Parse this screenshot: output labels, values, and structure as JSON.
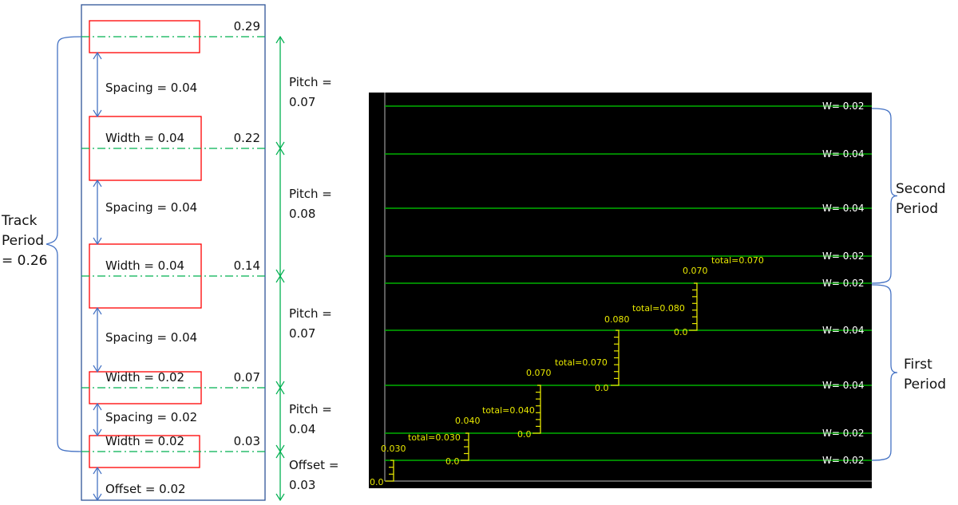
{
  "colors": {
    "frame": "#2f5597",
    "track": "#ff0000",
    "center": "#00b050",
    "arrow": "#4472c4",
    "pitch": "#00b050",
    "grid": "#00b000",
    "ruler": "#e8e800",
    "axis": "#999999",
    "bg": "#000000"
  },
  "left": {
    "track_values": [
      "0.29",
      "0.22",
      "0.14",
      "0.07",
      "0.03"
    ],
    "labels": [
      "Spacing = 0.04",
      "Width  = 0.04",
      "Spacing = 0.04",
      "Width = 0.04",
      "Spacing = 0.04",
      "Width = 0.02",
      "Spacing = 0.02",
      "Width = 0.02",
      "Offset = 0.02"
    ],
    "pitch": [
      [
        "Pitch =",
        "0.07"
      ],
      [
        "Pitch =",
        "0.08"
      ],
      [
        "Pitch =",
        "0.07"
      ],
      [
        "Pitch =",
        "0.04"
      ],
      [
        "Offset =",
        "0.03"
      ]
    ],
    "track_period": [
      "Track",
      "Period",
      "= 0.26"
    ]
  },
  "right": {
    "widths": [
      "W=  0.02",
      "W=  0.04",
      "W=  0.04",
      "W=  0.02",
      "W=  0.02",
      "W=  0.04",
      "W=  0.04",
      "W=  0.02",
      "W=  0.02"
    ],
    "rulers": [
      {
        "zero": "0.0",
        "value": "0.030",
        "total": ""
      },
      {
        "zero": "0.0",
        "value": "0.040",
        "total": "total=0.030"
      },
      {
        "zero": "0.0",
        "value": "0.070",
        "total": "total=0.040"
      },
      {
        "zero": "0.0",
        "value": "0.080",
        "total": "total=0.070"
      },
      {
        "zero": "0.0",
        "value": "0.070",
        "total": "total=0.080"
      }
    ],
    "extra_total": "total=0.070",
    "second_period": [
      "Second",
      "Period"
    ],
    "first_period": [
      "First",
      "Period"
    ]
  }
}
